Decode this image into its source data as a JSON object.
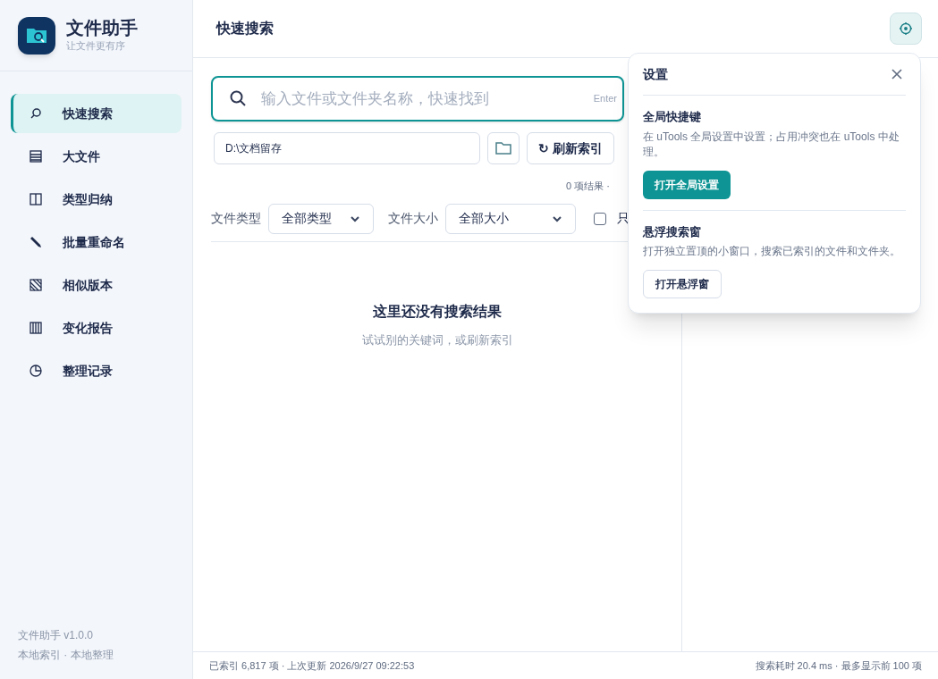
{
  "app": {
    "name": "文件助手",
    "tagline": "让文件更有序"
  },
  "nav": [
    {
      "kind": "search",
      "label": "快速搜索",
      "selected": true
    },
    {
      "kind": "list",
      "label": "大文件",
      "selected": false
    },
    {
      "kind": "columns",
      "label": "类型归纳",
      "selected": false
    },
    {
      "kind": "pencil",
      "label": "批量重命名",
      "selected": false
    },
    {
      "kind": "hatch",
      "label": "相似版本",
      "selected": false
    },
    {
      "kind": "bars",
      "label": "变化报告",
      "selected": false
    },
    {
      "kind": "clock",
      "label": "整理记录",
      "selected": false
    }
  ],
  "sidebar_footer": [
    "文件助手 v1.0.0",
    "本地索引 · 本地整理"
  ],
  "page_title": "快速搜索",
  "search": {
    "placeholder": "输入文件或文件夹名称，快速找到",
    "hint": "Enter"
  },
  "path": {
    "value": "D:\\文档留存"
  },
  "refresh_button": {
    "icon": "↻",
    "label": "刷新索引"
  },
  "result_count": "0 项结果 ·",
  "filters": [
    {
      "label": "文件类型",
      "value": "全部类型"
    },
    {
      "label": "文件大小",
      "value": "全部大小"
    }
  ],
  "only_checkbox": {
    "label": "只",
    "checked": false
  },
  "empty": {
    "title": "这里还没有搜索结果",
    "subtitle": "试试别的关键词，或刷新索引"
  },
  "status_bar": {
    "left": "已索引 6,817 项 · 上次更新 2026/9/27 09:22:53",
    "right": "搜索耗时 20.4 ms · 最多显示前 100 项"
  },
  "settings": {
    "title": "设置",
    "sections": [
      {
        "heading": "全局快捷键",
        "text": "在 uTools 全局设置中设置；占用冲突也在 uTools 中处理。",
        "button": "打开全局设置",
        "primary": true
      },
      {
        "heading": "悬浮搜索窗",
        "text": "打开独立置顶的小窗口，搜索已索引的文件和文件夹。",
        "button": "打开悬浮窗",
        "primary": false
      }
    ]
  }
}
